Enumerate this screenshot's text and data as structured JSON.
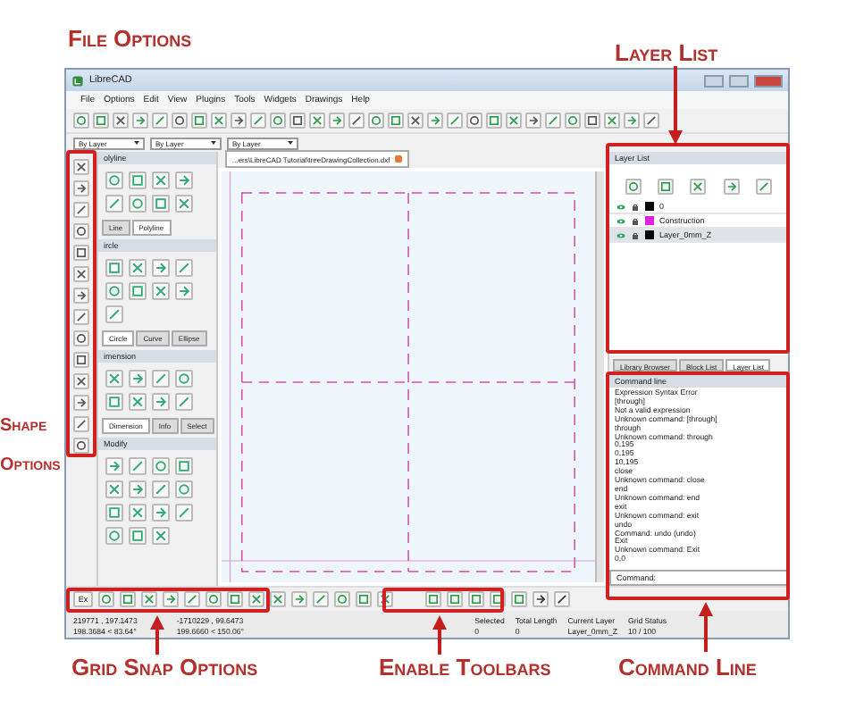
{
  "window": {
    "title": "LibreCAD"
  },
  "menu": [
    "File",
    "Options",
    "Edit",
    "View",
    "Plugins",
    "Tools",
    "Widgets",
    "Drawings",
    "Help"
  ],
  "pen_toolbar": [
    "By Layer",
    "By Layer",
    "By Layer"
  ],
  "dock_panels": [
    {
      "title": "olyline",
      "tabs": [
        {
          "label": "Line",
          "selected": false
        },
        {
          "label": "Polyline",
          "selected": true
        }
      ]
    },
    {
      "title": "ircle",
      "tabs": [
        {
          "label": "Circle",
          "selected": true
        },
        {
          "label": "Curve",
          "selected": false
        },
        {
          "label": "Ellipse",
          "selected": false
        }
      ]
    },
    {
      "title": "imension",
      "tabs": [
        {
          "label": "Dimension",
          "selected": true
        },
        {
          "label": "Info",
          "selected": false
        },
        {
          "label": "Select",
          "selected": false
        }
      ]
    },
    {
      "title": "Modify"
    }
  ],
  "document_tab": {
    "title": "...ers\\LibreCAD Tutorial\\treeDrawingCollection.dxf"
  },
  "layer_list": {
    "title": "Layer List",
    "layers": [
      {
        "name": "0",
        "color": "#000000",
        "selected": false
      },
      {
        "name": "Construction",
        "color": "#dd22dd",
        "selected": false
      },
      {
        "name": "Layer_0mm_Z",
        "color": "#000000",
        "selected": true
      }
    ]
  },
  "dock_tabs": [
    {
      "label": "Library Browser",
      "selected": false
    },
    {
      "label": "Block List",
      "selected": false
    },
    {
      "label": "Layer List",
      "selected": true
    }
  ],
  "command_line": {
    "title": "Command line",
    "history": [
      "Expression Syntax Error",
      "[through]",
      "Not a valid expression",
      "Unknown command: [through]",
      "through",
      "Unknown command: through",
      "0,195",
      "0,195",
      "10,195",
      "close",
      "Unknown command: close",
      "end",
      "Unknown command: end",
      "exit",
      "Unknown command: exit",
      "undo",
      "Command: undo (undo)",
      "Exit",
      "Unknown command: Exit",
      "0,0"
    ],
    "prompt": "Command:"
  },
  "snap_toolbar": {
    "first_button": "Ex"
  },
  "status_bar": {
    "absolute": [
      "219771 , 197.1473",
      "198.3684 < 83.64°"
    ],
    "relative": [
      "-1710229 , 99.6473",
      "199.6660 < 150.06°"
    ],
    "fields": [
      {
        "label": "Selected",
        "value": "0"
      },
      {
        "label": "Total Length",
        "value": "0"
      },
      {
        "label": "Current Layer",
        "value": "Layer_0mm_Z"
      },
      {
        "label": "Grid Status",
        "value": "10 / 100"
      }
    ]
  },
  "annotations": {
    "file_options": "File Options",
    "layer_list": "Layer List",
    "shape_options": "Shape Options",
    "grid_snap_options": "Grid Snap Options",
    "enable_toolbars": "Enable Toolbars",
    "command_line": "Command Line"
  }
}
